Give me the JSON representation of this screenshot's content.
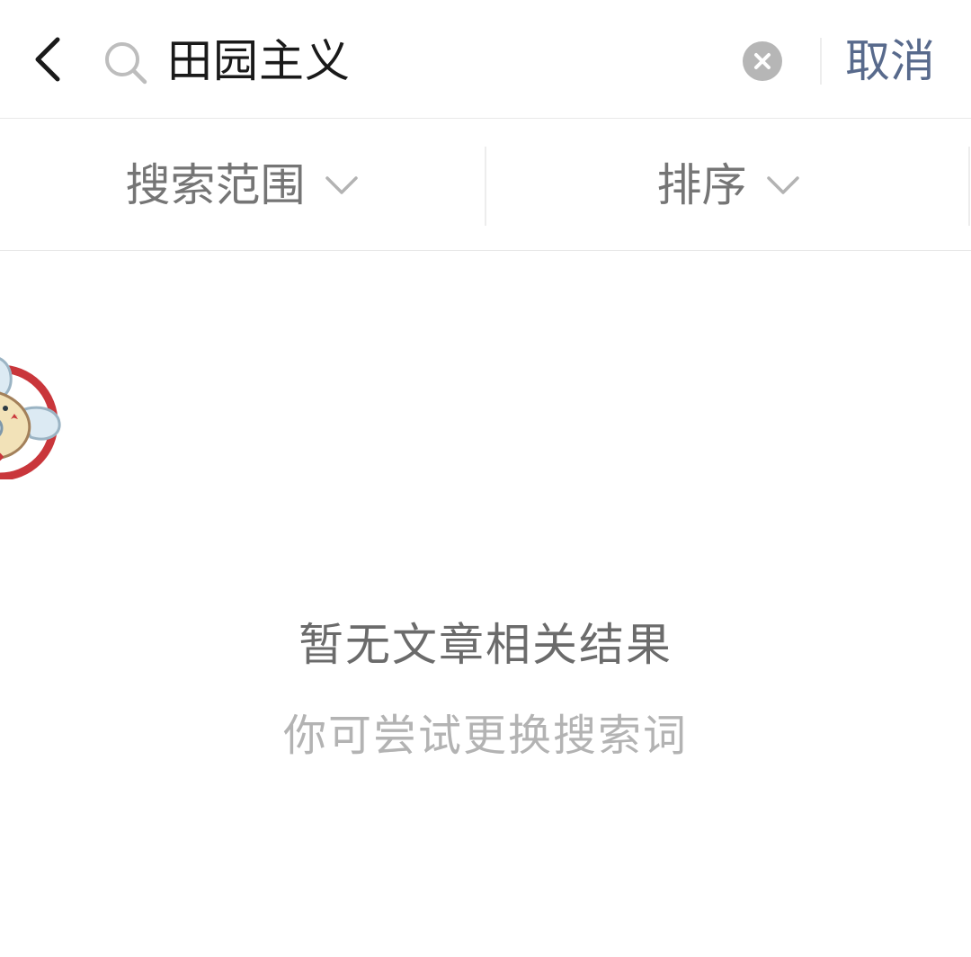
{
  "header": {
    "search_query": "田园主义",
    "cancel_label": "取消",
    "back_icon": "chevron-left-icon",
    "search_icon": "search-icon",
    "clear_icon": "clear-icon"
  },
  "filters": {
    "scope_label": "搜索范围",
    "sort_label": "排序",
    "dropdown_icon": "chevron-down-icon"
  },
  "empty_state": {
    "title": "暂无文章相关结果",
    "subtitle": "你可尝试更换搜索词"
  },
  "colors": {
    "cancel": "#586a8c",
    "primary_text": "#1a1a1a",
    "secondary_text": "#757575",
    "hint_text": "#b3b3b3",
    "divider": "#e8e8e8",
    "clear_button": "#b6b6b6"
  }
}
